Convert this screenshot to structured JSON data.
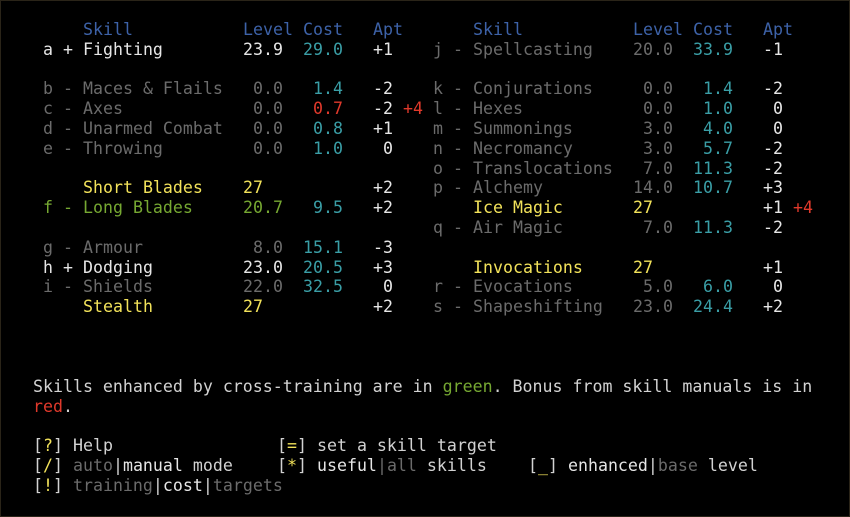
{
  "headers": {
    "skill": "Skill",
    "level": "Level",
    "cost": "Cost",
    "apt": "Apt"
  },
  "colors": {
    "header": "#3d62a8",
    "cost": "#3a9ea6",
    "maxed": "#f2e25a",
    "cross_trained": "#76a832",
    "manual_bonus": "#e0392b",
    "untrained": "#6b6b6b",
    "trained": "#e6e6e6"
  },
  "left_skills": [
    {
      "row": 1,
      "key": "a",
      "sign": "+",
      "name": "Fighting",
      "level": "23.9",
      "cost": "29.0",
      "apt": "+1",
      "style": "white"
    },
    {
      "row": 3,
      "key": "b",
      "sign": "-",
      "name": "Maces & Flails",
      "level": "0.0",
      "cost": "1.4",
      "apt": "-2",
      "style": "grey"
    },
    {
      "row": 4,
      "key": "c",
      "sign": "-",
      "name": "Axes",
      "level": "0.0",
      "cost": "0.7",
      "apt": "-2",
      "bonus": "+4",
      "style": "grey",
      "cost_style": "red"
    },
    {
      "row": 5,
      "key": "d",
      "sign": "-",
      "name": "Unarmed Combat",
      "level": "0.0",
      "cost": "0.8",
      "apt": "+1",
      "style": "grey"
    },
    {
      "row": 6,
      "key": "e",
      "sign": "-",
      "name": "Throwing",
      "level": "0.0",
      "cost": "1.0",
      "apt": "0",
      "style": "grey"
    },
    {
      "row": 8,
      "name": "Short Blades",
      "level": "27",
      "apt": "+2",
      "style": "yellow"
    },
    {
      "row": 9,
      "key": "f",
      "sign": "-",
      "name": "Long Blades",
      "level": "20.7",
      "cost": "9.5",
      "apt": "+2",
      "style": "green"
    },
    {
      "row": 11,
      "key": "g",
      "sign": "-",
      "name": "Armour",
      "level": "8.0",
      "cost": "15.1",
      "apt": "-3",
      "style": "grey"
    },
    {
      "row": 12,
      "key": "h",
      "sign": "+",
      "name": "Dodging",
      "level": "23.0",
      "cost": "20.5",
      "apt": "+3",
      "style": "white"
    },
    {
      "row": 13,
      "key": "i",
      "sign": "-",
      "name": "Shields",
      "level": "22.0",
      "cost": "32.5",
      "apt": "0",
      "style": "grey"
    },
    {
      "row": 14,
      "name": "Stealth",
      "level": "27",
      "apt": "+2",
      "style": "yellow"
    }
  ],
  "right_skills": [
    {
      "row": 1,
      "key": "j",
      "sign": "-",
      "name": "Spellcasting",
      "level": "20.0",
      "cost": "33.9",
      "apt": "-1",
      "style": "grey"
    },
    {
      "row": 3,
      "key": "k",
      "sign": "-",
      "name": "Conjurations",
      "level": "0.0",
      "cost": "1.4",
      "apt": "-2",
      "style": "grey"
    },
    {
      "row": 4,
      "key": "l",
      "sign": "-",
      "name": "Hexes",
      "level": "0.0",
      "cost": "1.0",
      "apt": "0",
      "style": "grey"
    },
    {
      "row": 5,
      "key": "m",
      "sign": "-",
      "name": "Summonings",
      "level": "3.0",
      "cost": "4.0",
      "apt": "0",
      "style": "grey"
    },
    {
      "row": 6,
      "key": "n",
      "sign": "-",
      "name": "Necromancy",
      "level": "3.0",
      "cost": "5.7",
      "apt": "-2",
      "style": "grey"
    },
    {
      "row": 7,
      "key": "o",
      "sign": "-",
      "name": "Translocations",
      "level": "7.0",
      "cost": "11.3",
      "apt": "-2",
      "style": "grey"
    },
    {
      "row": 8,
      "key": "p",
      "sign": "-",
      "name": "Alchemy",
      "level": "14.0",
      "cost": "10.7",
      "apt": "+3",
      "style": "grey"
    },
    {
      "row": 9,
      "name": "Ice Magic",
      "level": "27",
      "apt": "+1",
      "bonus": "+4",
      "style": "yellow"
    },
    {
      "row": 10,
      "key": "q",
      "sign": "-",
      "name": "Air Magic",
      "level": "7.0",
      "cost": "11.3",
      "apt": "-2",
      "style": "grey"
    },
    {
      "row": 12,
      "name": "Invocations",
      "level": "27",
      "apt": "+1",
      "style": "yellow"
    },
    {
      "row": 13,
      "key": "r",
      "sign": "-",
      "name": "Evocations",
      "level": "5.0",
      "cost": "6.0",
      "apt": "0",
      "style": "grey"
    },
    {
      "row": 14,
      "key": "s",
      "sign": "-",
      "name": "Shapeshifting",
      "level": "23.0",
      "cost": "24.4",
      "apt": "+2",
      "style": "grey"
    }
  ],
  "legend": {
    "part1": "Skills enhanced by cross-training are in ",
    "green_word": "green",
    "part2": ". Bonus from skill manuals is in",
    "red_word": "red",
    "part3": "."
  },
  "commands": {
    "help": {
      "key": "?",
      "label": "Help"
    },
    "target": {
      "key": "=",
      "label": "set a skill target"
    },
    "mode": {
      "key": "/",
      "opt1": "auto",
      "opt2": "manual",
      "suffix": " mode"
    },
    "useful": {
      "key": "*",
      "opt1": "useful",
      "opt2": "all",
      "suffix": " skills"
    },
    "enhanced": {
      "key": "_",
      "opt1": "enhanced",
      "opt2": "base",
      "suffix": " level"
    },
    "view": {
      "key": "!",
      "opt1": "training",
      "opt2": "cost",
      "opt3": "targets"
    }
  }
}
